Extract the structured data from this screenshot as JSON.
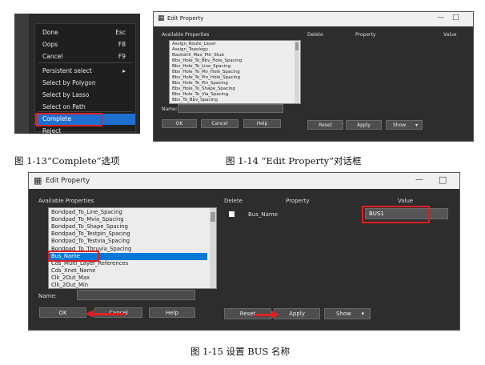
{
  "fig13": {
    "menu": [
      {
        "label": "Done",
        "shortcut": "Esc"
      },
      {
        "label": "Oops",
        "shortcut": "F8"
      },
      {
        "label": "Cancel",
        "shortcut": "F9"
      },
      {
        "label": "Persistent select",
        "shortcut": "▸"
      },
      {
        "label": "Select by Polygon",
        "shortcut": ""
      },
      {
        "label": "Select by Lasso",
        "shortcut": ""
      },
      {
        "label": "Select on Path",
        "shortcut": ""
      },
      {
        "label": "Complete",
        "shortcut": ""
      },
      {
        "label": "Reject",
        "shortcut": ""
      }
    ],
    "selected_index": 7,
    "caption": "图 1-13“Complete”选项"
  },
  "fig14": {
    "title": "Edit Property",
    "headers": {
      "available": "Available Properties",
      "delete": "Delete",
      "property": "Property",
      "value": "Value"
    },
    "items": [
      "Assign_Route_Layer",
      "Assign_Topology",
      "Backdrill_Max_Pth_Stub",
      "Bbv_Hole_To_Bbv_Hole_Spacing",
      "Bbv_Hole_To_Line_Spacing",
      "Bbv_Hole_To_Mv_Hole_Spacing",
      "Bbv_Hole_To_Pin_Hole_Spacing",
      "Bbv_Hole_To_Pin_Spacing",
      "Bbv_Hole_To_Shape_Spacing",
      "Bbv_Hole_To_Via_Spacing",
      "Bbv_To_Bbv_Spacing"
    ],
    "name_label": "Name:",
    "buttons": {
      "ok": "OK",
      "cancel": "Cancel",
      "help": "Help",
      "reset": "Reset",
      "apply": "Apply",
      "show": "Show"
    },
    "caption": "图 1-14 “Edit Property”对话框"
  },
  "fig15": {
    "title": "Edit Property",
    "headers": {
      "available": "Available Properties",
      "delete": "Delete",
      "property": "Property",
      "value": "Value"
    },
    "items": [
      "Bondpad_To_Line_Spacing",
      "Bondpad_To_Mvia_Spacing",
      "Bondpad_To_Shape_Spacing",
      "Bondpad_To_Testpin_Spacing",
      "Bondpad_To_Testvia_Spacing",
      "Bondpad_To_Thruvia_Spacing",
      "Bus_Name",
      "Cds_Multi_Layer_References",
      "Cds_Xnet_Name",
      "Clk_2Out_Max",
      "Clk_2Out_Min"
    ],
    "selected_index": 6,
    "row": {
      "property": "Bus_Name",
      "value": "BUS1"
    },
    "name_label": "Name:",
    "buttons": {
      "ok": "OK",
      "cancel": "Cancel",
      "help": "Help",
      "reset": "Reset",
      "apply": "Apply",
      "show": "Show"
    },
    "caption": "图 1-15 设置 BUS 名称"
  },
  "colors": {
    "accent": "#1e6fd0",
    "highlight": "#e02020",
    "dialog_bg": "#2d2d2d"
  }
}
